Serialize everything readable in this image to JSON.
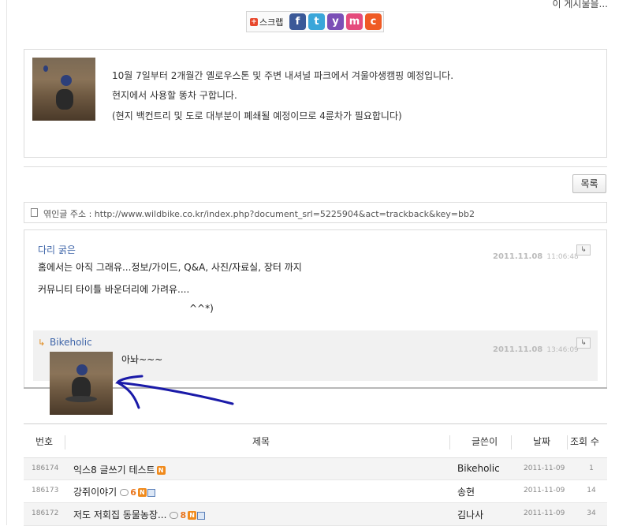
{
  "top": {
    "truncated_text": "이 게시물을..."
  },
  "scrap": {
    "label": "스크랩",
    "buttons": [
      {
        "name": "facebook",
        "glyph": "f",
        "color": "#3b5998"
      },
      {
        "name": "twitter",
        "glyph": "t",
        "color": "#3aa6d9"
      },
      {
        "name": "yozm",
        "glyph": "y",
        "color": "#7b4fb6"
      },
      {
        "name": "me2day",
        "glyph": "m",
        "color": "#e54b7c"
      },
      {
        "name": "cyworld",
        "glyph": "c",
        "color": "#ef5a24"
      }
    ]
  },
  "post": {
    "lines": [
      "10월 7일부터 2개월간 옐로우스톤 및 주변 내셔널 파크에서 겨울야생캠핑 예정입니다.",
      "현지에서 사용할 똥차 구합니다.",
      "(현지 백컨트리  및 도로 대부분이 폐쇄될 예정이므로 4륜차가 필요합니다)"
    ]
  },
  "list_button": "목록",
  "trackback": {
    "text": "엮인글 주소 : http://www.wildbike.co.kr/index.php?document_srl=5225904&act=trackback&key=bb2"
  },
  "comments": [
    {
      "author": "다리 굵은",
      "date": "2011.11.08",
      "time": "11:06:48",
      "lines": [
        "홈에서는 아직 그래유...정보/가이드, Q&A, 사진/자료실, 장터 까지",
        "커뮤니티 타이틀 바운더리에 가려유....",
        "^^*)"
      ]
    },
    {
      "reply_mark": "↳",
      "author": "Bikeholic",
      "date": "2011.11.08",
      "time": "13:46:09",
      "lines": [
        "아놔~~~"
      ]
    }
  ],
  "reply_glyph": "↳",
  "board": {
    "headers": [
      "번호",
      "제목",
      "글쓴이",
      "날짜",
      "조회 수"
    ],
    "rows": [
      {
        "no": "186174",
        "title": "익스8 글쓰기 테스트",
        "author": "Bikeholic",
        "date": "2011-11-09",
        "views": "1",
        "comments": "",
        "new": true,
        "file": false
      },
      {
        "no": "186173",
        "title": "강쥐이야기",
        "author": "송현",
        "date": "2011-11-09",
        "views": "14",
        "comments": "6",
        "new": true,
        "file": true
      },
      {
        "no": "186172",
        "title": "저도 저회집 동물농장...",
        "author": "김나사",
        "date": "2011-11-09",
        "views": "34",
        "comments": "8",
        "new": true,
        "file": true
      }
    ],
    "new_badge": "N"
  },
  "colors": {
    "author_link": "#3d64a8",
    "new_badge": "#f08a1c",
    "annotation_arrow": "#1a1aa8"
  }
}
